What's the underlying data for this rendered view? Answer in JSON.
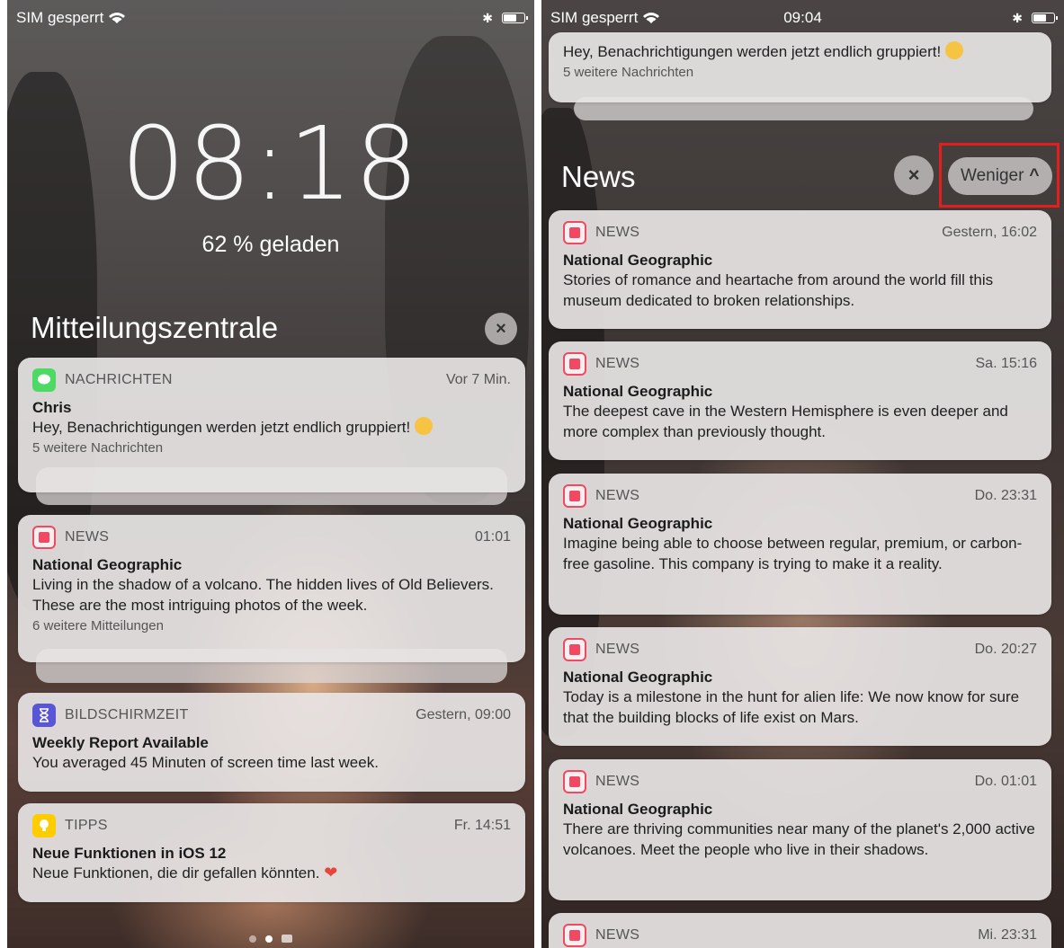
{
  "left": {
    "status": {
      "carrier": "SIM gesperrt"
    },
    "clock": "08:18",
    "charge": "62 % geladen",
    "section_title": "Mitteilungszentrale",
    "close_glyph": "×",
    "notifications": [
      {
        "app": "NACHRICHTEN",
        "icon": "messages-icon",
        "time": "Vor 7 Min.",
        "title": "Chris",
        "body": "Hey, Benachrichtigungen werden jetzt endlich gruppiert!",
        "more": "5 weitere Nachrichten"
      },
      {
        "app": "NEWS",
        "icon": "news-icon",
        "time": "01:01",
        "title": "National Geographic",
        "body": "Living in the shadow of a volcano. The hidden lives of Old Believers. These are the most intriguing photos of the week.",
        "more": "6 weitere Mitteilungen"
      },
      {
        "app": "BILDSCHIRMZEIT",
        "icon": "hourglass-icon",
        "time": "Gestern, 09:00",
        "title": "Weekly Report Available",
        "body": "You averaged 45 Minuten of screen time last week."
      },
      {
        "app": "TIPPS",
        "icon": "lightbulb-icon",
        "time": "Fr. 14:51",
        "title": "Neue Funktionen in iOS 12",
        "body": "Neue Funktionen, die dir gefallen könnten."
      }
    ]
  },
  "right": {
    "status": {
      "carrier": "SIM gesperrt",
      "time": "09:04"
    },
    "top_card": {
      "body": "Hey, Benachrichtigungen werden jetzt endlich gruppiert!",
      "more": "5 weitere Nachrichten"
    },
    "group_title": "News",
    "close_glyph": "×",
    "less_label": "Weniger",
    "less_glyph": "^",
    "highlight_color": "#e41d1d",
    "notifications": [
      {
        "app": "NEWS",
        "time": "Gestern, 16:02",
        "title": "National Geographic",
        "body": "Stories of romance and heartache from around the world fill this museum dedicated to broken relationships."
      },
      {
        "app": "NEWS",
        "time": "Sa. 15:16",
        "title": "National Geographic",
        "body": "The deepest cave in the Western Hemisphere is even deeper and more complex than previously thought."
      },
      {
        "app": "NEWS",
        "time": "Do. 23:31",
        "title": "National Geographic",
        "body": "Imagine being able to choose between regular, premium, or carbon-free gasoline. This company is trying to make it a reality."
      },
      {
        "app": "NEWS",
        "time": "Do. 20:27",
        "title": "National Geographic",
        "body": "Today is a milestone in the hunt for alien life: We now know for sure that the building blocks of life exist on Mars."
      },
      {
        "app": "NEWS",
        "time": "Do. 01:01",
        "title": "National Geographic",
        "body": "There are thriving communities near many of the planet's 2,000 active volcanoes. Meet the people who live in their shadows."
      },
      {
        "app": "NEWS",
        "time": "Mi. 23:31"
      }
    ]
  }
}
